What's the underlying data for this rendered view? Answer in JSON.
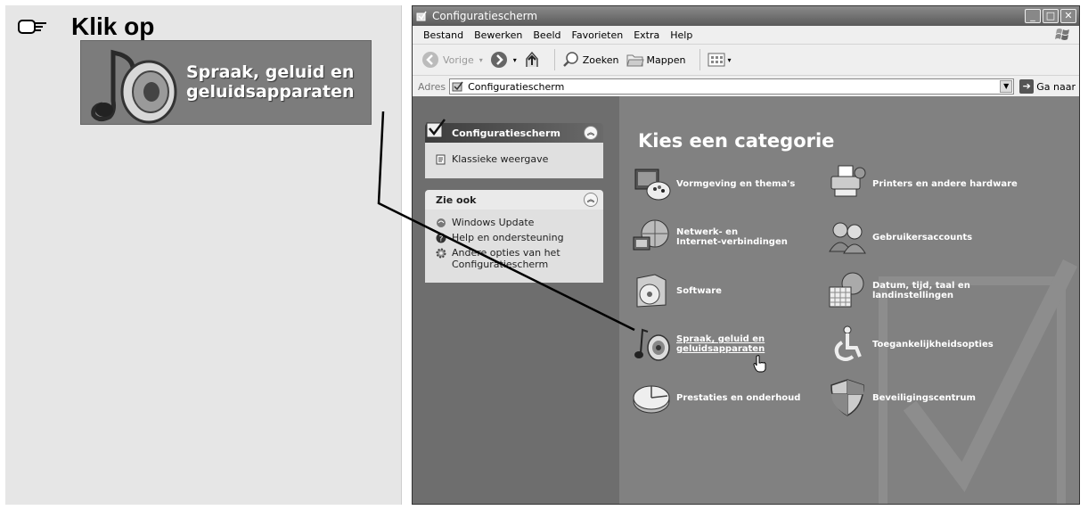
{
  "instruction": {
    "text": "Klik op",
    "callout_text": "Spraak, geluid en\ngeluidsapparaten"
  },
  "window": {
    "title": "Configuratiescherm",
    "controls": {
      "minimize": "_",
      "maximize": "□",
      "close": "✕"
    },
    "menu": [
      "Bestand",
      "Bewerken",
      "Beeld",
      "Favorieten",
      "Extra",
      "Help"
    ],
    "toolbar": {
      "back": "Vorige",
      "search": "Zoeken",
      "folders": "Mappen"
    },
    "address": {
      "label": "Adres",
      "value": "Configuratiescherm",
      "go": "Ga naar"
    }
  },
  "sidebar": {
    "panel1": {
      "title": "Configuratiescherm",
      "link": "Klassieke weergave"
    },
    "panel2": {
      "title": "Zie ook",
      "links": [
        "Windows Update",
        "Help en ondersteuning",
        "Andere opties van het\nConfiguratiescherm"
      ]
    }
  },
  "main": {
    "title": "Kies een categorie",
    "categories": [
      {
        "label": "Vormgeving en thema's",
        "icon": "appearance-icon"
      },
      {
        "label": "Printers en andere hardware",
        "icon": "printer-icon"
      },
      {
        "label": "Netwerk- en\nInternet-verbindingen",
        "icon": "network-icon"
      },
      {
        "label": "Gebruikersaccounts",
        "icon": "users-icon"
      },
      {
        "label": "Software",
        "icon": "software-icon"
      },
      {
        "label": "Datum, tijd, taal en\nlandinstellingen",
        "icon": "calendar-icon"
      },
      {
        "label": "Spraak, geluid en\ngeluidsapparaten",
        "icon": "speaker-icon"
      },
      {
        "label": "Toegankelijkheidsopties",
        "icon": "accessibility-icon"
      },
      {
        "label": "Prestaties en onderhoud",
        "icon": "performance-icon"
      },
      {
        "label": "Beveiligingscentrum",
        "icon": "shield-icon"
      }
    ]
  }
}
